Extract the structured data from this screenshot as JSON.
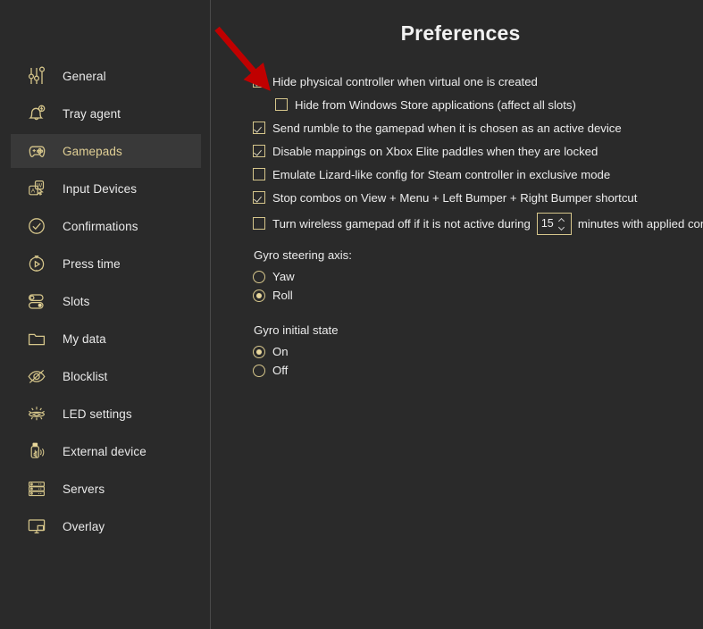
{
  "colors": {
    "background": "#2a2a2a",
    "accent_gold": "#d6c68b",
    "active_row": "#393939",
    "text": "#ececec",
    "active_label": "#e0cf95",
    "annotation_arrow": "#c00000",
    "divider": "#4a4a4a"
  },
  "sidebar": {
    "items": [
      {
        "label": "General",
        "icon": "sliders-icon",
        "active": false
      },
      {
        "label": "Tray agent",
        "icon": "bell-bolt-icon",
        "active": false
      },
      {
        "label": "Gamepads",
        "icon": "gamepad-icon",
        "active": true
      },
      {
        "label": "Input Devices",
        "icon": "keyboard-keys-icon",
        "active": false
      },
      {
        "label": "Confirmations",
        "icon": "check-circle-icon",
        "active": false
      },
      {
        "label": "Press time",
        "icon": "stopwatch-play-icon",
        "active": false
      },
      {
        "label": "Slots",
        "icon": "toggles-icon",
        "active": false
      },
      {
        "label": "My data",
        "icon": "folder-icon",
        "active": false
      },
      {
        "label": "Blocklist",
        "icon": "eye-slash-icon",
        "active": false
      },
      {
        "label": "LED settings",
        "icon": "led-rays-icon",
        "active": false
      },
      {
        "label": "External device",
        "icon": "usb-bluetooth-icon",
        "active": false
      },
      {
        "label": "Servers",
        "icon": "server-rack-icon",
        "active": false
      },
      {
        "label": "Overlay",
        "icon": "monitor-icon",
        "active": false
      }
    ]
  },
  "main": {
    "title": "Preferences",
    "checkboxes": [
      {
        "label": "Hide physical controller when virtual one is created",
        "checked": true,
        "indent": false
      },
      {
        "label": "Hide from Windows Store applications (affect all slots)",
        "checked": false,
        "indent": true
      },
      {
        "label": "Send rumble to the gamepad when it is chosen as an active device",
        "checked": true,
        "indent": false
      },
      {
        "label": "Disable mappings on Xbox Elite paddles when they are locked",
        "checked": true,
        "indent": false
      },
      {
        "label": "Emulate Lizard-like config for Steam controller in exclusive mode",
        "checked": false,
        "indent": false
      },
      {
        "label": "Stop combos on View + Menu + Left Bumper + Right Bumper shortcut",
        "checked": true,
        "indent": false
      }
    ],
    "wireless_row": {
      "checked": false,
      "label_before": "Turn wireless gamepad off if it is not active during",
      "spinner_value": "15",
      "label_after": "minutes with applied config"
    },
    "groups": [
      {
        "title": "Gyro steering axis:",
        "options": [
          {
            "label": "Yaw",
            "selected": false
          },
          {
            "label": "Roll",
            "selected": true
          }
        ]
      },
      {
        "title": "Gyro initial state",
        "options": [
          {
            "label": "On",
            "selected": true
          },
          {
            "label": "Off",
            "selected": false
          }
        ]
      }
    ]
  },
  "annotation": {
    "type": "arrow",
    "points_to": "Hide physical controller when virtual one is created",
    "color": "#c00000"
  }
}
